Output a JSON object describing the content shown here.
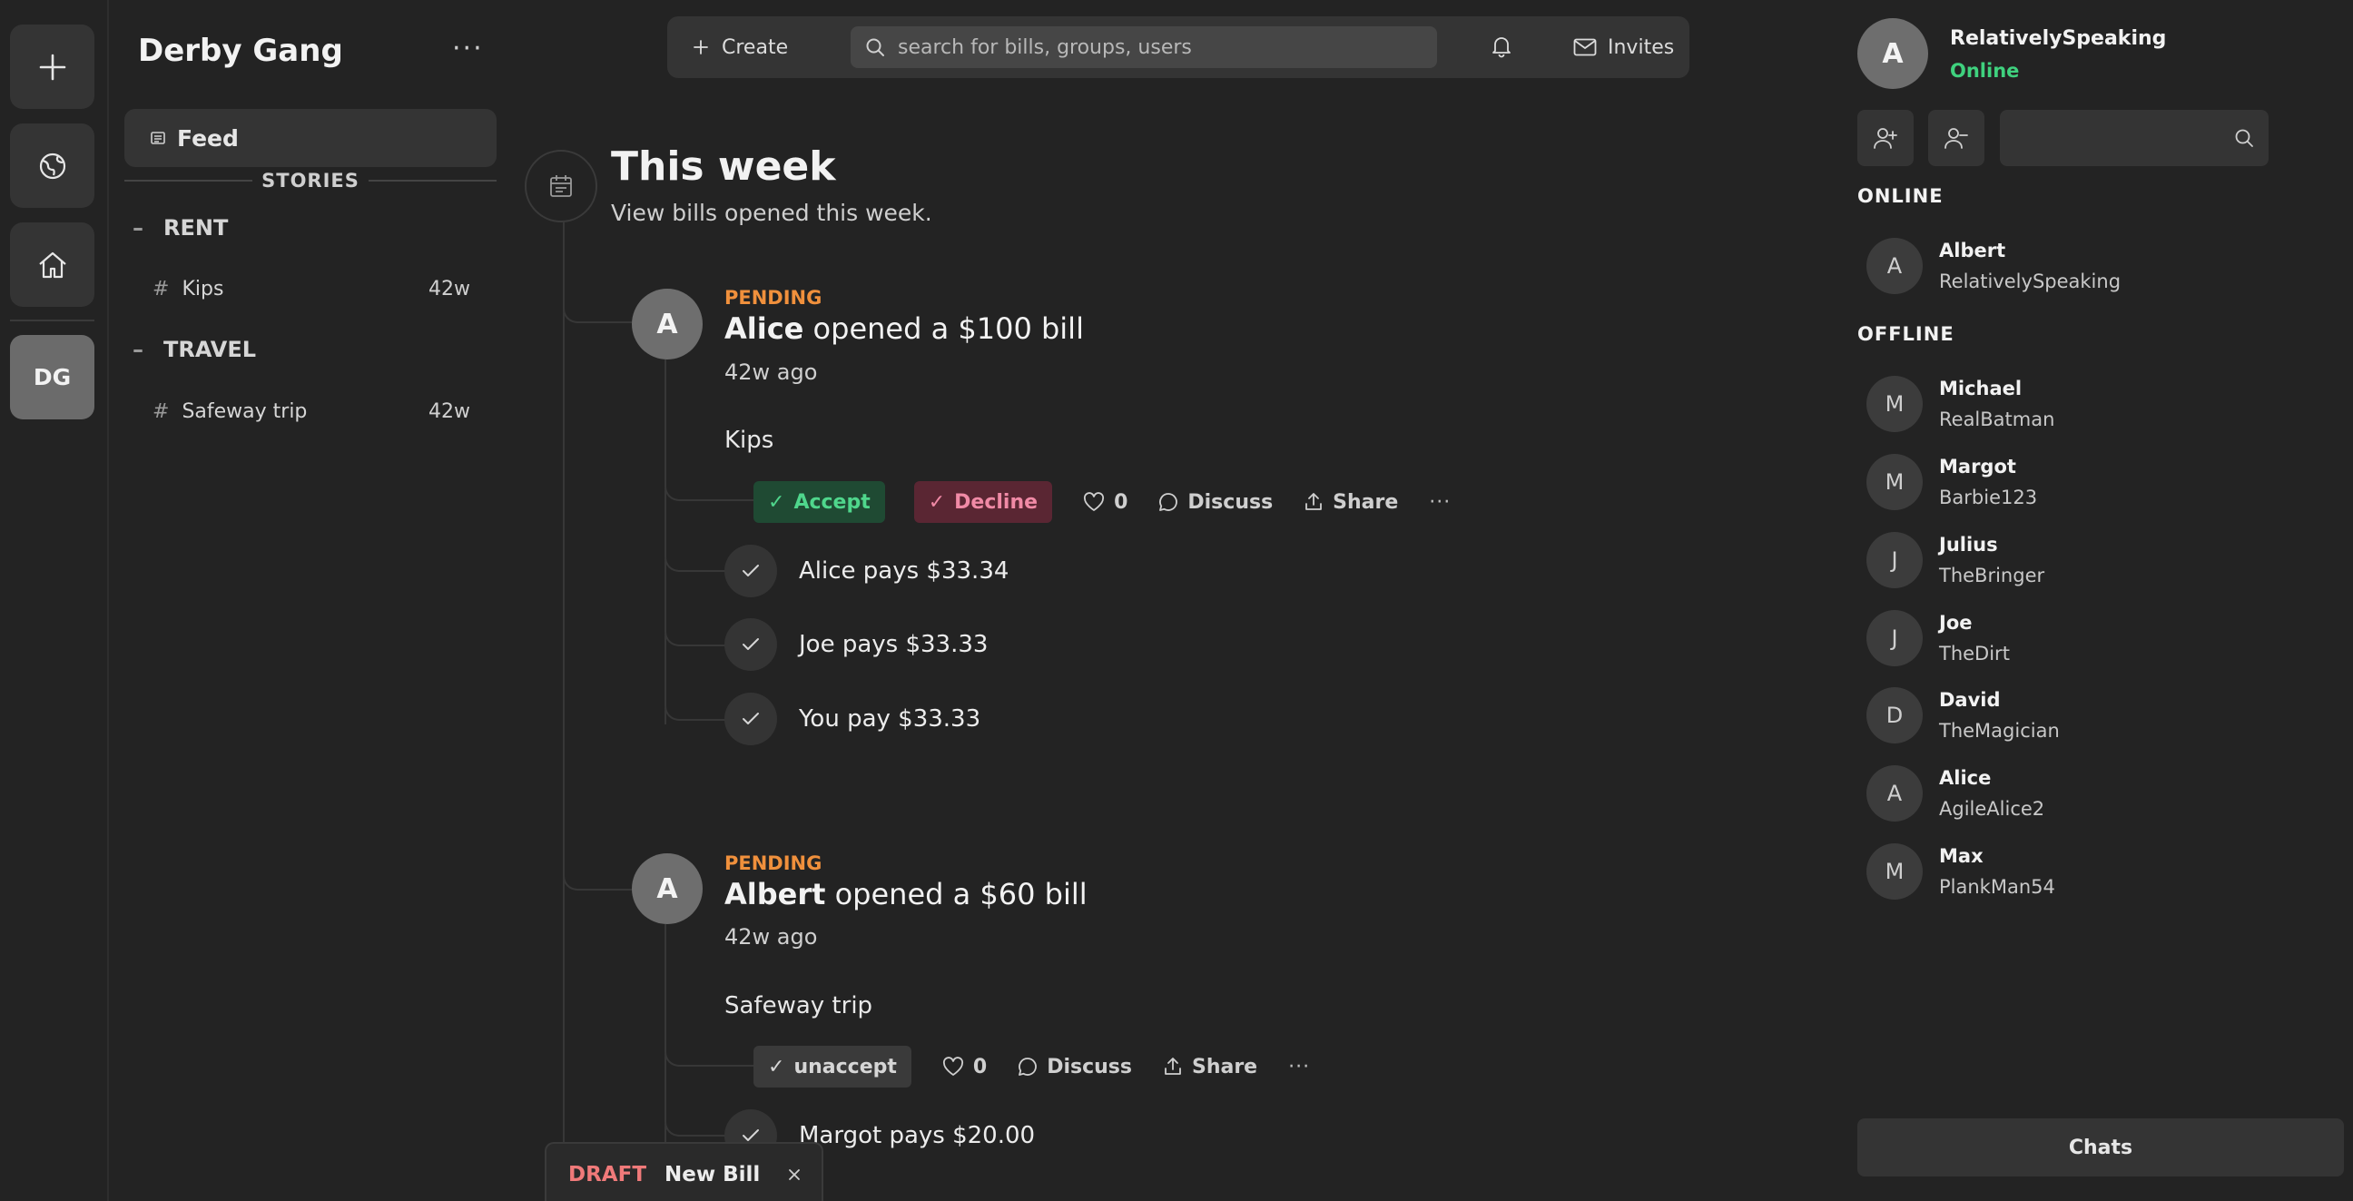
{
  "rail": {
    "group_initials": "DG"
  },
  "group": {
    "title": "Derby Gang",
    "more": "···",
    "feed_label": "Feed",
    "stories_label": "STORIES",
    "categories": [
      {
        "name": "RENT",
        "channels": [
          {
            "name": "Kips",
            "age": "42w"
          }
        ]
      },
      {
        "name": "TRAVEL",
        "channels": [
          {
            "name": "Safeway trip",
            "age": "42w"
          }
        ]
      }
    ]
  },
  "topbar": {
    "create_label": "Create",
    "search_placeholder": "search for bills, groups, users",
    "invites_label": "Invites"
  },
  "feed": {
    "week_title": "This week",
    "week_subtitle": "View bills opened this week.",
    "bills": [
      {
        "avatar": "A",
        "status": "PENDING",
        "author": "Alice",
        "action_text": " opened a $100 bill",
        "time": "42w ago",
        "name": "Kips",
        "accept_label": "Accept",
        "decline_label": "Decline",
        "likes": "0",
        "discuss_label": "Discuss",
        "share_label": "Share",
        "more": "···",
        "payments": [
          "Alice pays $33.34",
          "Joe pays $33.33",
          "You pay $33.33"
        ]
      },
      {
        "avatar": "A",
        "status": "PENDING",
        "author": "Albert",
        "action_text": " opened a $60 bill",
        "time": "42w ago",
        "name": "Safeway trip",
        "unaccept_label": "unaccept",
        "likes": "0",
        "discuss_label": "Discuss",
        "share_label": "Share",
        "more": "···",
        "payments": [
          "Margot pays $20.00"
        ]
      }
    ]
  },
  "draft": {
    "tag": "DRAFT",
    "name": "New Bill"
  },
  "me": {
    "avatar": "A",
    "name": "RelativelySpeaking",
    "status": "Online"
  },
  "people": {
    "online_label": "ONLINE",
    "offline_label": "OFFLINE",
    "online": [
      {
        "initial": "A",
        "name": "Albert",
        "handle": "RelativelySpeaking"
      }
    ],
    "offline": [
      {
        "initial": "M",
        "name": "Michael",
        "handle": "RealBatman"
      },
      {
        "initial": "M",
        "name": "Margot",
        "handle": "Barbie123"
      },
      {
        "initial": "J",
        "name": "Julius",
        "handle": "TheBringer"
      },
      {
        "initial": "J",
        "name": "Joe",
        "handle": "TheDirt"
      },
      {
        "initial": "D",
        "name": "David",
        "handle": "TheMagician"
      },
      {
        "initial": "A",
        "name": "Alice",
        "handle": "AgileAlice2"
      },
      {
        "initial": "M",
        "name": "Max",
        "handle": "PlankMan54"
      }
    ]
  },
  "chats_label": "Chats",
  "colors": {
    "background": "#232323",
    "panel": "#343434",
    "pending": "#f0903c",
    "online": "#3fd17e",
    "accept": "#4fd68c",
    "decline": "#f08aa6",
    "draft": "#f07a7a"
  }
}
